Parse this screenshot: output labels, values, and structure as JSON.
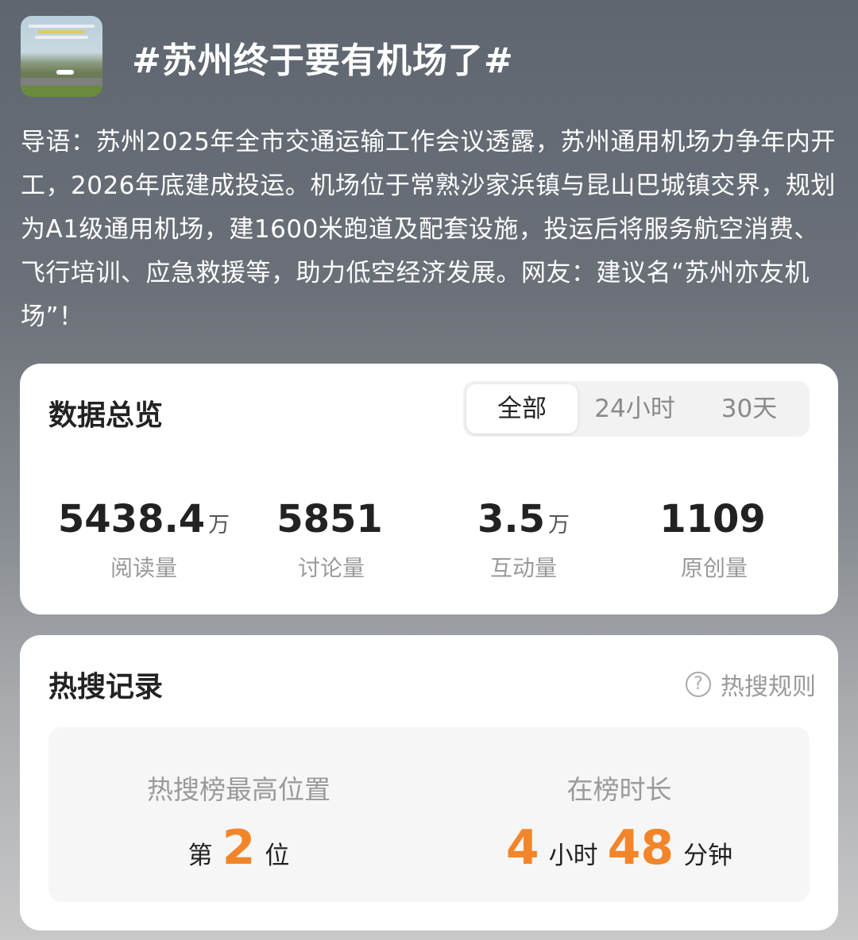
{
  "topic": {
    "thumbnail_icon": "airport-thumbnail",
    "title": "#苏州终于要有机场了#",
    "intro": "导语：苏州2025年全市交通运输工作会议透露，苏州通用机场力争年内开工，2026年底建成投运。机场位于常熟沙家浜镇与昆山巴城镇交界，规划为A1级通用机场，建1600米跑道及配套设施，投运后将服务航空消费、飞行培训、应急救援等，助力低空经济发展。网友：建议名“苏州亦友机场”！"
  },
  "overview": {
    "title": "数据总览",
    "tabs": [
      {
        "label": "全部",
        "active": true
      },
      {
        "label": "24小时",
        "active": false
      },
      {
        "label": "30天",
        "active": false
      }
    ],
    "stats": [
      {
        "value": "5438.4",
        "unit": "万",
        "label": "阅读量"
      },
      {
        "value": "5851",
        "unit": "",
        "label": "讨论量"
      },
      {
        "value": "3.5",
        "unit": "万",
        "label": "互动量"
      },
      {
        "value": "1109",
        "unit": "",
        "label": "原创量"
      }
    ]
  },
  "hot_search": {
    "title": "热搜记录",
    "rules_link": "热搜规则",
    "help_icon": "question-circle-icon",
    "highest_position": {
      "heading": "热搜榜最高位置",
      "prefix": "第",
      "rank": "2",
      "suffix": "位"
    },
    "duration": {
      "heading": "在榜时长",
      "hours": "4",
      "hours_unit": "小时",
      "minutes": "48",
      "minutes_unit": "分钟"
    }
  },
  "colors": {
    "accent_orange": "#f2852a",
    "card_bg": "#ffffff"
  }
}
